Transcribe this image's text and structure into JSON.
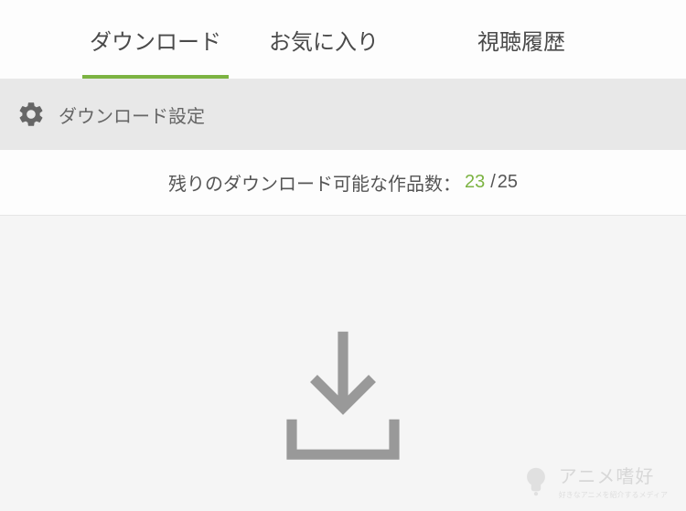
{
  "tabs": {
    "download": "ダウンロード",
    "favorites": "お気に入り",
    "history": "視聴履歴"
  },
  "settings": {
    "label": "ダウンロード設定"
  },
  "quota": {
    "label": "残りのダウンロード可能な作品数：",
    "current": "23",
    "separator": "/",
    "max": "25"
  },
  "watermark": {
    "text": "アニメ嗜好",
    "sub": "好きなアニメを紹介するメディア"
  }
}
